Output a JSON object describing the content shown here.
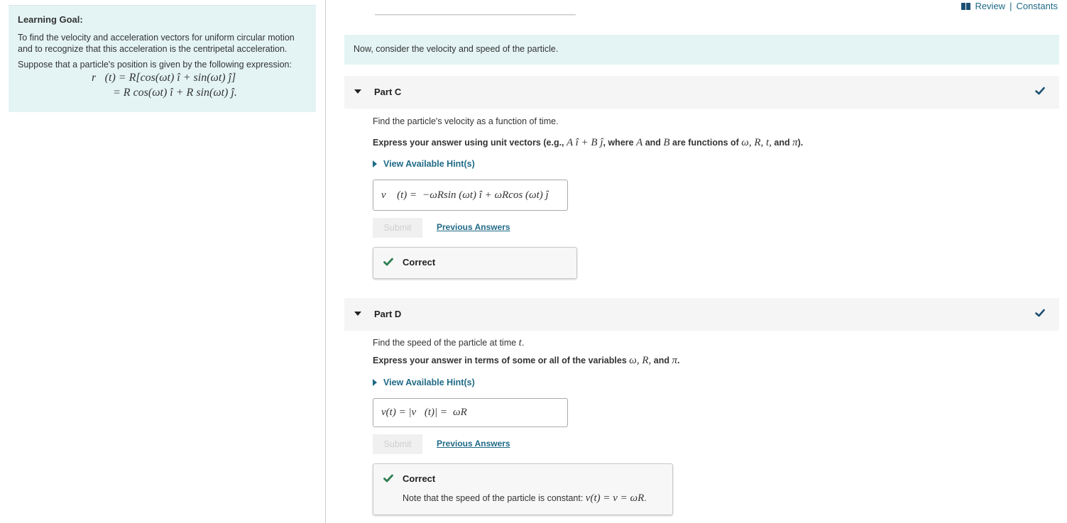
{
  "header": {
    "review_label": "Review",
    "separator": "|",
    "constants_label": "Constants",
    "icon": "book-icon"
  },
  "learning_goal": {
    "title": "Learning Goal:",
    "goal_text": "To find the velocity and acceleration vectors for uniform circular motion and to recognize that this acceleration is the centripetal acceleration.",
    "suppose_text": "Suppose that a particle's position is given by the following expression:",
    "equation_line1": "r⃗(t) = R[cos(ωt) î + sin(ωt) ĵ]",
    "equation_line2": "= R cos(ωt) î + R sin(ωt) ĵ."
  },
  "intro": {
    "text": "Now, consider the velocity and speed of the particle."
  },
  "parts": [
    {
      "title": "Part C",
      "completed": true,
      "question": "Find the particle's velocity as a function of time.",
      "instruction_prefix": "Express your answer using unit vectors (e.g., ",
      "instruction_math": "A î + B ĵ",
      "instruction_mid": ", where ",
      "instruction_A": "A",
      "instruction_and": " and ",
      "instruction_B": "B",
      "instruction_suffix": " are functions of ",
      "instruction_vars": "ω, R, t,",
      "instruction_and2": " and ",
      "instruction_pi": "π",
      "instruction_end": ").",
      "hint_label": "View Available Hint(s)",
      "answer_label": "v⃗ (t) =",
      "answer_value": "−ωRsin (ωt) î + ωRcos (ωt) ĵ",
      "submit_label": "Submit",
      "previous_answers_label": "Previous Answers",
      "feedback_title": "Correct",
      "feedback_note": ""
    },
    {
      "title": "Part D",
      "completed": true,
      "question_prefix": "Find the speed of the particle at time ",
      "question_var": "t",
      "question_end": ".",
      "instruction_prefix": "Express your answer in terms of some or all of the variables ",
      "instruction_vars": "ω, R,",
      "instruction_and": " and ",
      "instruction_pi": "π",
      "instruction_end": ".",
      "hint_label": "View Available Hint(s)",
      "answer_label": "v(t) = |v⃗(t)| =",
      "answer_value": "ωR",
      "submit_label": "Submit",
      "previous_answers_label": "Previous Answers",
      "feedback_title": "Correct",
      "feedback_note_prefix": "Note that the speed of the particle is constant: ",
      "feedback_note_math": "v(t) = v = ωR",
      "feedback_note_end": "."
    }
  ],
  "colors": {
    "accent": "#1f6a86",
    "banner_bg": "#e4f4f5",
    "part_header_bg": "#f5f5f5",
    "correct_green": "#2e7d4f",
    "complete_check": "#1d4f73"
  }
}
